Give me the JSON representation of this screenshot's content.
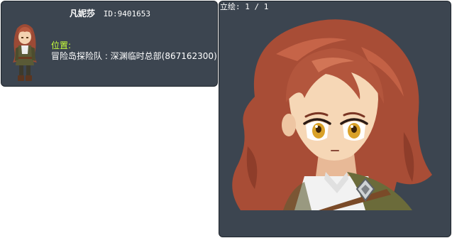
{
  "character": {
    "name": "凡妮莎",
    "id_text": "ID:9401653"
  },
  "location": {
    "label": "位置:",
    "value": "冒险岛探险队 : 深渊临时总部(867162300)"
  },
  "portrait": {
    "counter": "立绘: 1 / 1"
  },
  "colors": {
    "panel_bg": "#3c4550",
    "label_green": "#c8ff3a",
    "text_white": "#ffffff"
  }
}
